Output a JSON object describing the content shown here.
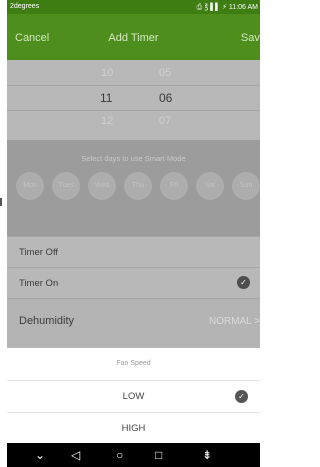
{
  "status_bar": {
    "app_name": "2degrees",
    "right_text": "⎙ ℥ ▌▌ ⚡ 11:06 AM"
  },
  "header": {
    "cancel_label": "Cancel",
    "title": "Add Timer",
    "save_label": "Save"
  },
  "time_picker": {
    "hours": [
      "10",
      "11",
      "12"
    ],
    "minutes": [
      "05",
      "06",
      "07"
    ],
    "selected_hour": "11",
    "selected_minute": "06"
  },
  "days": {
    "label": "Select days to use Smart Mode",
    "items": [
      "Mon",
      "Tues",
      "Wed",
      "Thu",
      "Fri",
      "Sat",
      "Sun"
    ]
  },
  "timer_rows": [
    {
      "label": "Timer Off",
      "selected": false
    },
    {
      "label": "Timer On",
      "selected": true
    }
  ],
  "mode_row": {
    "label": "Dehumidity",
    "value": "NORMAL >"
  },
  "fan_speed": {
    "title": "Fan Speed",
    "options": [
      {
        "label": "LOW",
        "selected": true
      },
      {
        "label": "HIGH",
        "selected": false
      }
    ]
  },
  "colors": {
    "header_green": "#4e8e1c",
    "status_green": "#3d7d12"
  },
  "navbar": {
    "icons": [
      "chevron-down-icon",
      "back-icon",
      "home-icon",
      "recents-icon",
      "download-icon"
    ]
  }
}
